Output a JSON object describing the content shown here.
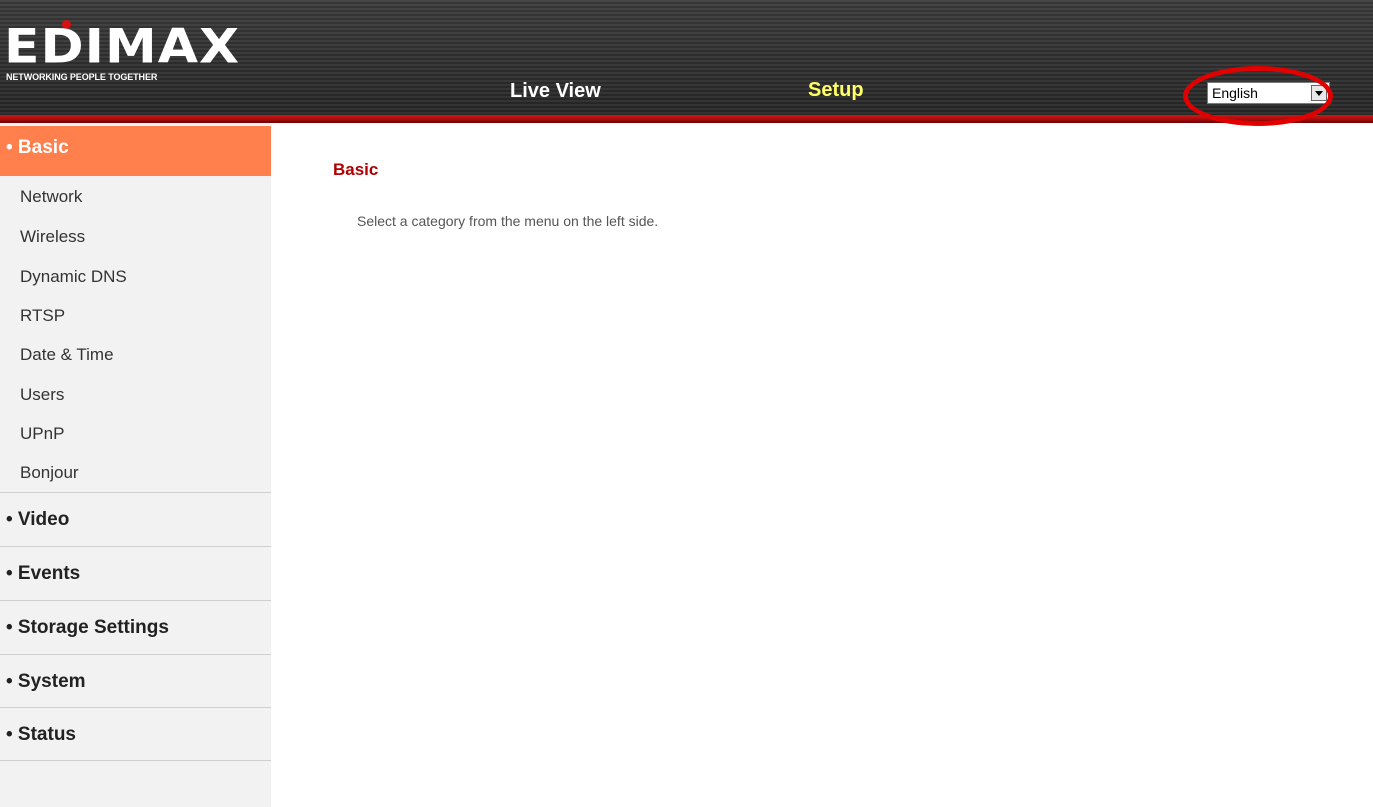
{
  "header": {
    "logo": {
      "word": "EDIMAX",
      "tagline": "NETWORKING PEOPLE TOGETHER"
    },
    "nav": [
      {
        "label": "Live View"
      },
      {
        "label": "Setup"
      }
    ],
    "language": {
      "selected": "English"
    }
  },
  "sidebar": {
    "active_section": "• Basic",
    "sub_items": [
      "Network",
      "Wireless",
      "Dynamic DNS",
      "RTSP",
      "Date & Time",
      "Users",
      "UPnP",
      "Bonjour"
    ],
    "sections": [
      "• Video",
      "• Events",
      "• Storage Settings",
      "• System",
      "• Status"
    ]
  },
  "main": {
    "title": "Basic",
    "message": "Select a category from the menu on the left side."
  },
  "colors": {
    "accent": "#ff7f4d",
    "title_red": "#b00000",
    "setup_yellow": "#ffff66",
    "highlight_ring": "#e00000"
  }
}
